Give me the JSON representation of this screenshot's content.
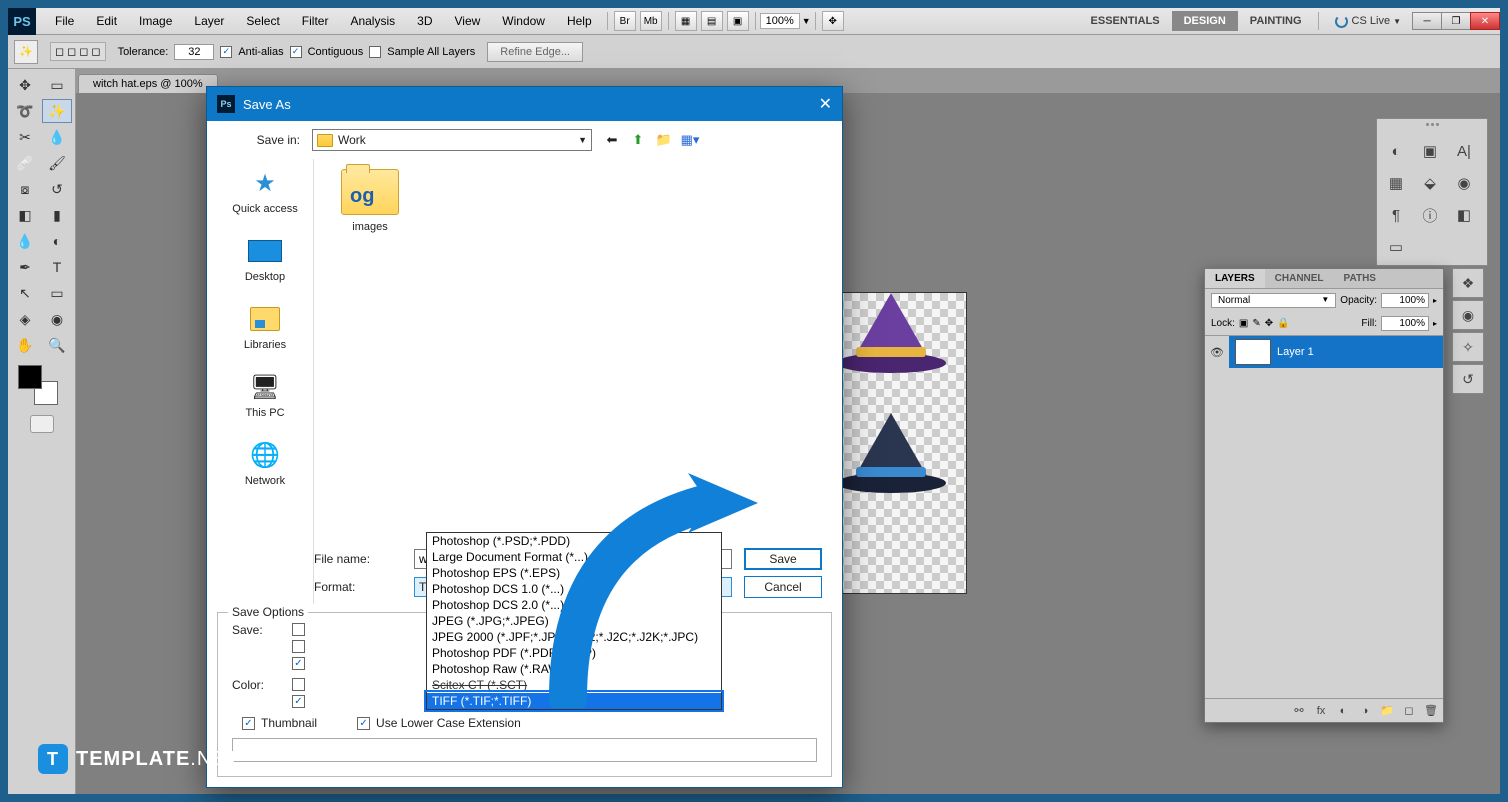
{
  "menubar": {
    "items": [
      "File",
      "Edit",
      "Image",
      "Layer",
      "Select",
      "Filter",
      "Analysis",
      "3D",
      "View",
      "Window",
      "Help"
    ],
    "br_label": "Br",
    "mb_label": "Mb",
    "zoom": "100%",
    "workspaces": [
      "ESSENTIALS",
      "DESIGN",
      "PAINTING"
    ],
    "active_workspace": 1,
    "cslive": "CS Live"
  },
  "options": {
    "tolerance_label": "Tolerance:",
    "tolerance_value": "32",
    "anti_alias": "Anti-alias",
    "contiguous": "Contiguous",
    "sample_all": "Sample All Layers",
    "refine": "Refine Edge..."
  },
  "doc_tab": "witch hat.eps @ 100%",
  "places": {
    "quick_access": "Quick access",
    "desktop": "Desktop",
    "libraries": "Libraries",
    "this_pc": "This PC",
    "network": "Network"
  },
  "dialog": {
    "title": "Save As",
    "save_in_label": "Save in:",
    "save_in_value": "Work",
    "folder_item": "images",
    "filename_label": "File name:",
    "filename_value": "witch hat.tif",
    "format_label": "Format:",
    "format_value": "TIFF (*.TIF;*.TIFF)",
    "save_btn": "Save",
    "cancel_btn": "Cancel",
    "format_options": [
      "Photoshop (*.PSD;*.PDD)",
      "Large Document Format (*...)",
      "Photoshop EPS (*.EPS)",
      "Photoshop DCS 1.0 (*...)",
      "Photoshop DCS 2.0 (*...)",
      "JPEG (*.JPG;*.JPEG)",
      "JPEG 2000 (*.JPF;*.JPX;*.JP2;*.J2C;*.J2K;*.JPC)",
      "Photoshop PDF (*.PDF;*.PDP)",
      "Photoshop Raw (*.RAW)",
      "Scitex CT (*.SCT)",
      "TIFF (*.TIF;*.TIFF)"
    ],
    "save_options_legend": "Save Options",
    "save_label": "Save:",
    "color_label": "Color:",
    "thumbnail": "Thumbnail",
    "lowercase": "Use Lower Case Extension"
  },
  "layers": {
    "tabs": [
      "LAYERS",
      "CHANNEL",
      "PATHS"
    ],
    "blend": "Normal",
    "opacity_label": "Opacity:",
    "opacity_value": "100%",
    "lock_label": "Lock:",
    "fill_label": "Fill:",
    "fill_value": "100%",
    "layer_name": "Layer 1"
  },
  "watermark": {
    "brand": "TEMPLATE",
    "suffix": ".NET"
  }
}
